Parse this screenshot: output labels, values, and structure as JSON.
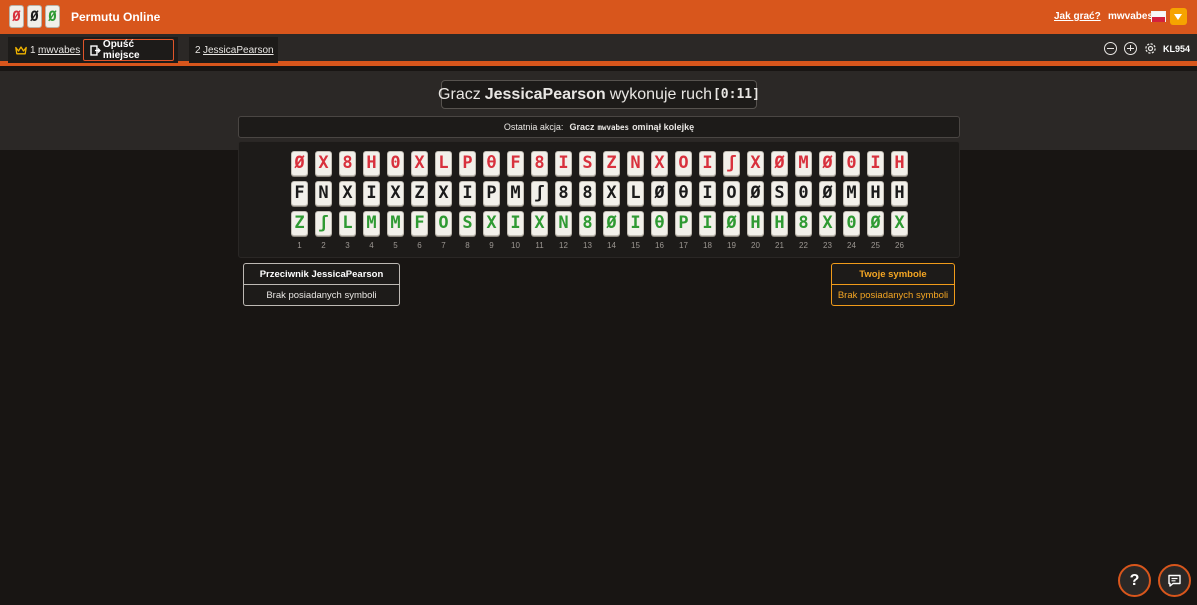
{
  "header": {
    "logo_tiles": [
      {
        "glyph": "Ø",
        "color": "#d8313d"
      },
      {
        "glyph": "Ø",
        "color": "#1b1b1b"
      },
      {
        "glyph": "Ø",
        "color": "#2f9a33"
      }
    ],
    "brand": "Permutu Online",
    "help_link": "Jak grać?",
    "username": "mwvabes",
    "flag": "poland-flag",
    "menu_icon": "chevron-down-icon"
  },
  "players_bar": {
    "player1": {
      "number": "1",
      "name": "mwvabes",
      "icon": "crown-icon"
    },
    "leave_button": "Opuść miejsce",
    "player2": {
      "number": "2",
      "name": "JessicaPearson"
    },
    "controls": [
      "zoom-out-icon",
      "zoom-in-icon",
      "gear-icon"
    ],
    "room_code": "KL954"
  },
  "status": {
    "prefix": "Gracz",
    "player": "JessicaPearson",
    "suffix": "wykonuje ruch",
    "timer": "[0:11]"
  },
  "last_action": {
    "label": "Ostatnia akcja:",
    "prefix": "Gracz",
    "player": "mwvabes",
    "suffix": "ominął kolejkę"
  },
  "board": {
    "colors": {
      "red": "#d8313d",
      "black": "#1b1b1b",
      "green": "#2f9a33"
    },
    "rows": [
      {
        "color": "red",
        "glyphs": [
          "Ø",
          "X",
          "8",
          "H",
          "0",
          "X",
          "L",
          "P",
          "θ",
          "F",
          "8",
          "I",
          "S",
          "Z",
          "N",
          "X",
          "O",
          "I",
          "ʃ",
          "X",
          "Ø",
          "M",
          "Ø",
          "0",
          "I",
          "H"
        ]
      },
      {
        "color": "black",
        "glyphs": [
          "F",
          "N",
          "X",
          "I",
          "X",
          "Z",
          "X",
          "I",
          "P",
          "M",
          "ʃ",
          "8",
          "8",
          "X",
          "L",
          "Ø",
          "θ",
          "I",
          "O",
          "Ø",
          "S",
          "0",
          "Ø",
          "M",
          "H",
          "H"
        ]
      },
      {
        "color": "green",
        "glyphs": [
          "Z",
          "ʃ",
          "L",
          "M",
          "M",
          "F",
          "O",
          "S",
          "X",
          "I",
          "X",
          "N",
          "8",
          "Ø",
          "I",
          "θ",
          "P",
          "I",
          "Ø",
          "H",
          "H",
          "8",
          "X",
          "0",
          "Ø",
          "X"
        ]
      }
    ],
    "column_numbers": [
      "1",
      "2",
      "3",
      "4",
      "5",
      "6",
      "7",
      "8",
      "9",
      "10",
      "11",
      "12",
      "13",
      "14",
      "15",
      "16",
      "17",
      "18",
      "19",
      "20",
      "21",
      "22",
      "23",
      "24",
      "25",
      "26"
    ]
  },
  "opponent_panel": {
    "title": "Przeciwnik JessicaPearson",
    "body": "Brak posiadanych symboli"
  },
  "my_panel": {
    "title": "Twoje symbole",
    "body": "Brak posiadanych symboli"
  },
  "floating_buttons": {
    "help": "?",
    "help_icon": "question-icon",
    "chat_icon": "chat-icon"
  }
}
